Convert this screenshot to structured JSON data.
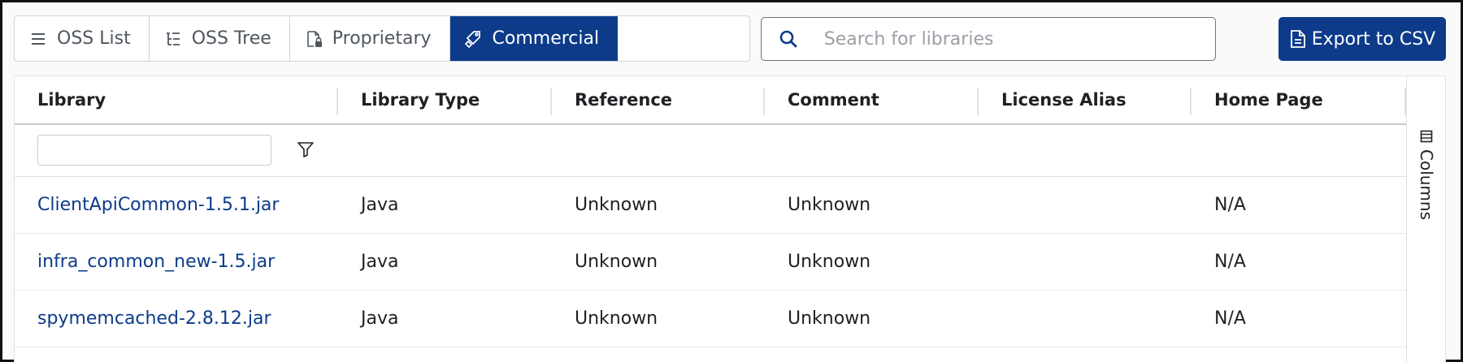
{
  "toolbar": {
    "tabs": [
      {
        "label": "OSS List",
        "icon": "list-icon"
      },
      {
        "label": "OSS Tree",
        "icon": "tree-icon"
      },
      {
        "label": "Proprietary",
        "icon": "locked-file-icon"
      },
      {
        "label": "Commercial",
        "icon": "commercial-tag-icon",
        "active": true
      }
    ],
    "search_placeholder": "Search for libraries",
    "export_label": "Export to CSV"
  },
  "grid": {
    "columns": [
      "Library",
      "Library Type",
      "Reference",
      "Comment",
      "License Alias",
      "Home Page"
    ],
    "filter_value": "",
    "rows": [
      {
        "library": "ClientApiCommon-1.5.1.jar",
        "type": "Java",
        "reference": "Unknown",
        "comment": "Unknown",
        "license_alias": "",
        "home_page": "N/A"
      },
      {
        "library": "infra_common_new-1.5.jar",
        "type": "Java",
        "reference": "Unknown",
        "comment": "Unknown",
        "license_alias": "",
        "home_page": "N/A"
      },
      {
        "library": "spymemcached-2.8.12.jar",
        "type": "Java",
        "reference": "Unknown",
        "comment": "Unknown",
        "license_alias": "",
        "home_page": "N/A"
      }
    ],
    "side_panel": {
      "columns_label": "Columns"
    }
  },
  "colors": {
    "primary": "#0d3b8a",
    "border": "#cfd3d8"
  }
}
